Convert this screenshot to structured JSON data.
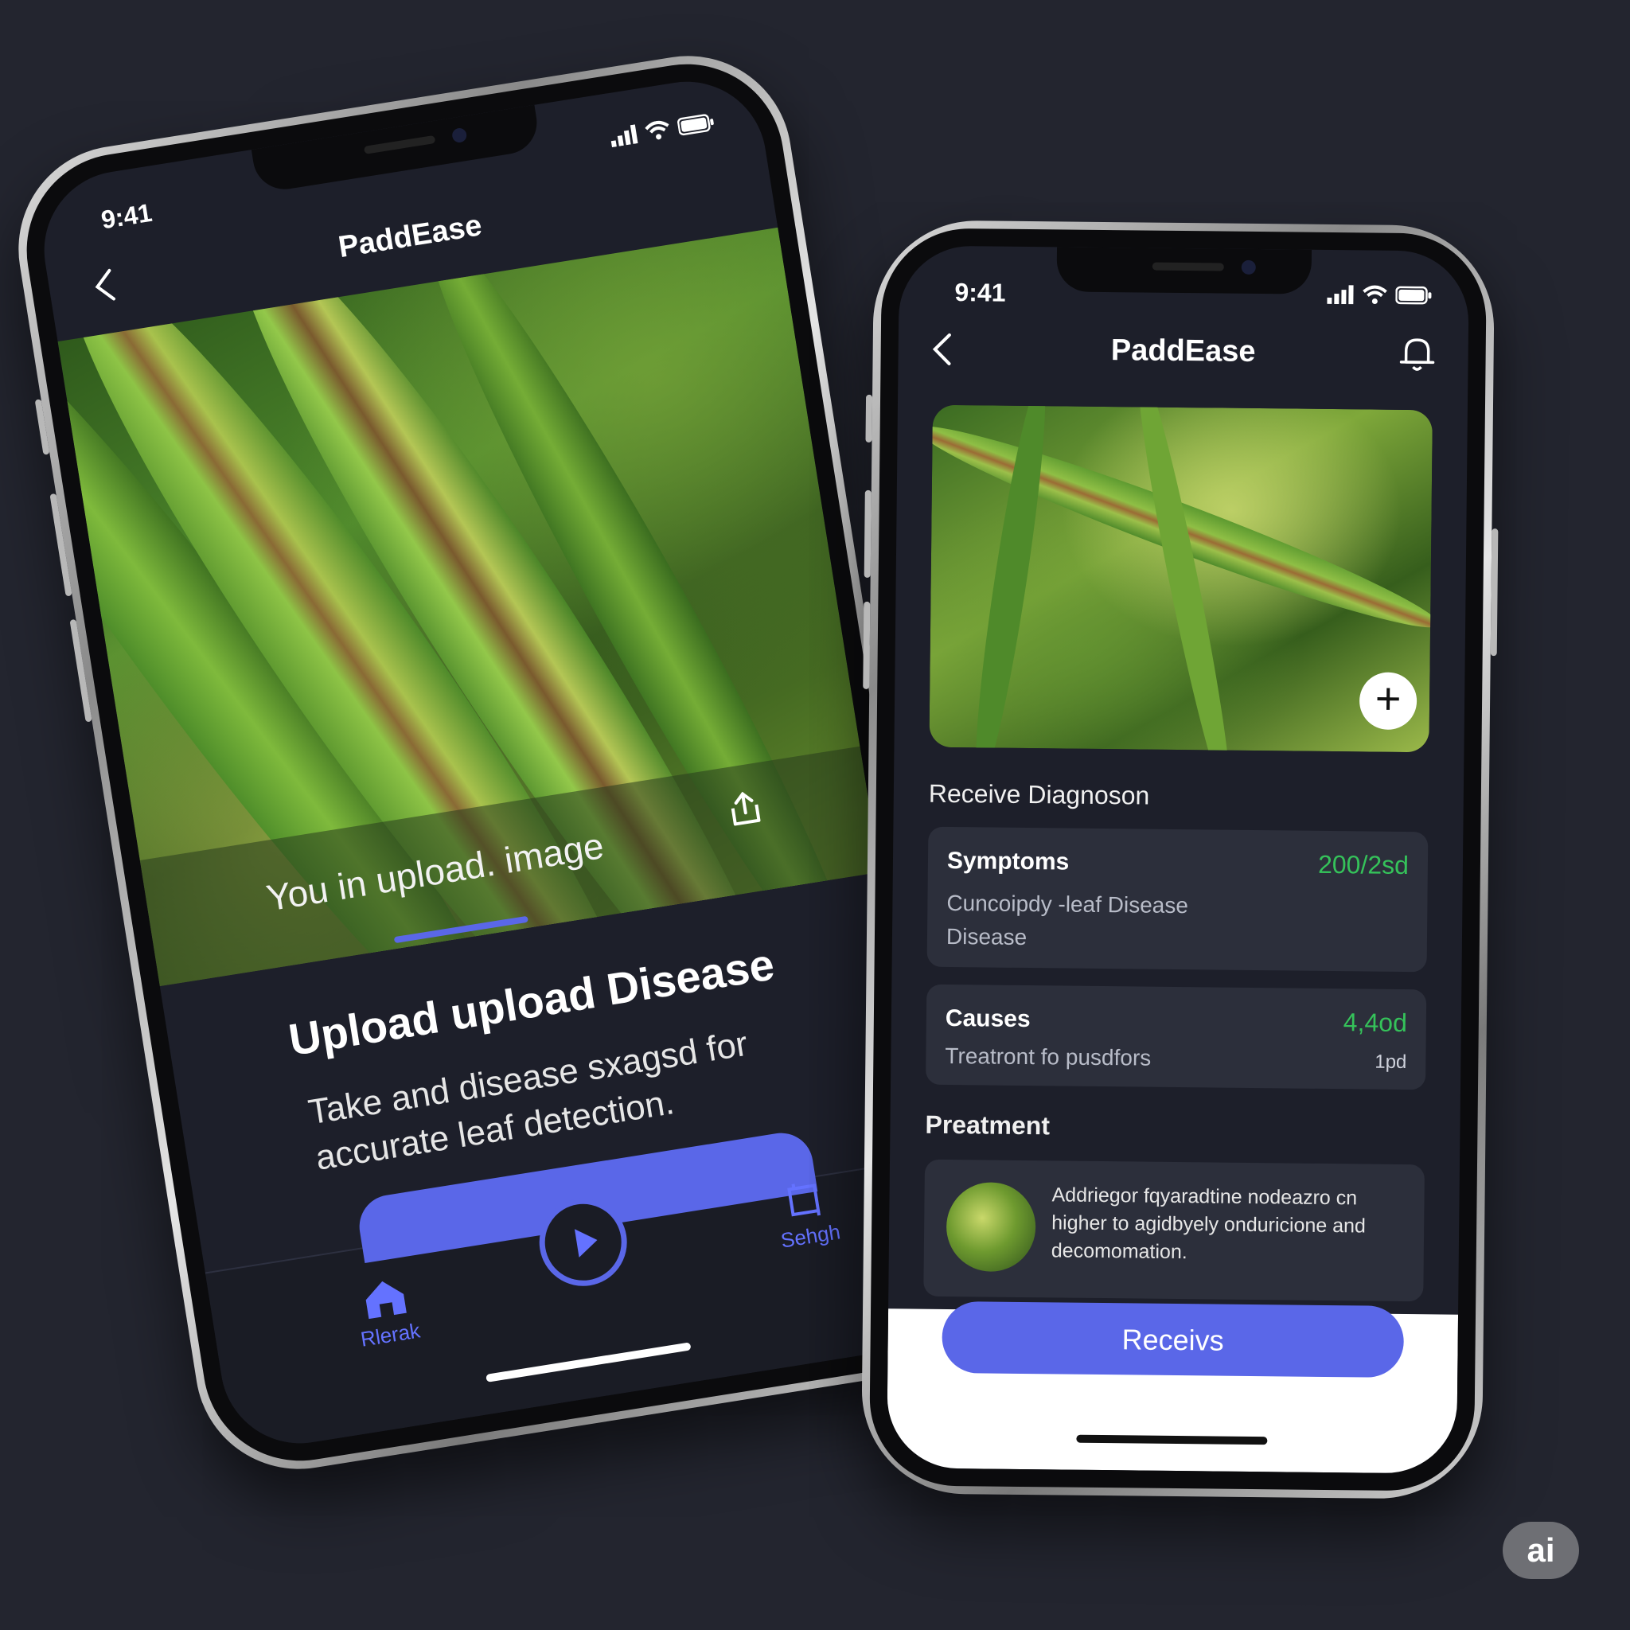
{
  "left_phone": {
    "status": {
      "time": "9:41"
    },
    "header": {
      "title": "PaddEase"
    },
    "upload_overlay": {
      "text": "You in upload. image",
      "progress": 0.3
    },
    "content": {
      "title": "Upload upload Disease",
      "description": "Take and disease sxagsd for accurate leaf detection."
    },
    "tabs": [
      {
        "label": "Rlerak",
        "icon": "home-icon"
      },
      {
        "label": "",
        "icon": "play-icon"
      },
      {
        "label": "Sehgh",
        "icon": "crop-icon"
      }
    ]
  },
  "right_phone": {
    "status": {
      "time": "9:41"
    },
    "header": {
      "title": "PaddEase"
    },
    "diagnosis_title": "Receive Diagnoson",
    "symptoms": {
      "title": "Symptoms",
      "value": "200/2sd",
      "line1": "Cuncoipdy -leaf Disease",
      "line2": "Disease"
    },
    "causes": {
      "title": "Causes",
      "value": "4,4od",
      "line1": "Treatront fo pusdfors",
      "small": "1pd"
    },
    "treatment_title": "Preatment",
    "treatment_text": "Addriegor fqyaradtine nodeazro cn higher to agidbyely onduricione and decomomation.",
    "cta_label": "Receivs"
  },
  "badge": {
    "label": "ai"
  },
  "colors": {
    "accent": "#5a67e8",
    "positive": "#35c25a",
    "background": "#23252f"
  }
}
